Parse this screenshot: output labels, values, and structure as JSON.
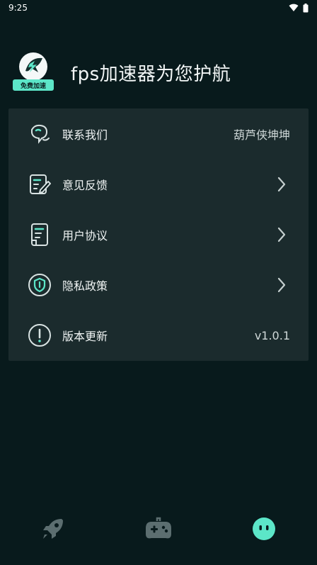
{
  "status_bar": {
    "time": "9:25"
  },
  "header": {
    "title": "fps加速器为您护航",
    "logo_badge": "免费加速"
  },
  "menu": {
    "items": [
      {
        "label": "联系我们",
        "value": "葫芦侠坤坤",
        "icon": "contact-icon"
      },
      {
        "label": "意见反馈",
        "icon": "feedback-icon"
      },
      {
        "label": "用户协议",
        "icon": "agreement-icon"
      },
      {
        "label": "隐私政策",
        "icon": "privacy-shield-icon"
      },
      {
        "label": "版本更新",
        "value": "v1.0.1",
        "icon": "update-alert-icon"
      }
    ]
  },
  "tabbar": {
    "tabs": [
      {
        "icon": "rocket-icon",
        "active": false
      },
      {
        "icon": "gamepad-icon",
        "active": false
      },
      {
        "icon": "profile-face-icon",
        "active": true
      }
    ]
  },
  "colors": {
    "background": "#081a1c",
    "card": "#1b2b2d",
    "accent": "#5ce6c8"
  }
}
